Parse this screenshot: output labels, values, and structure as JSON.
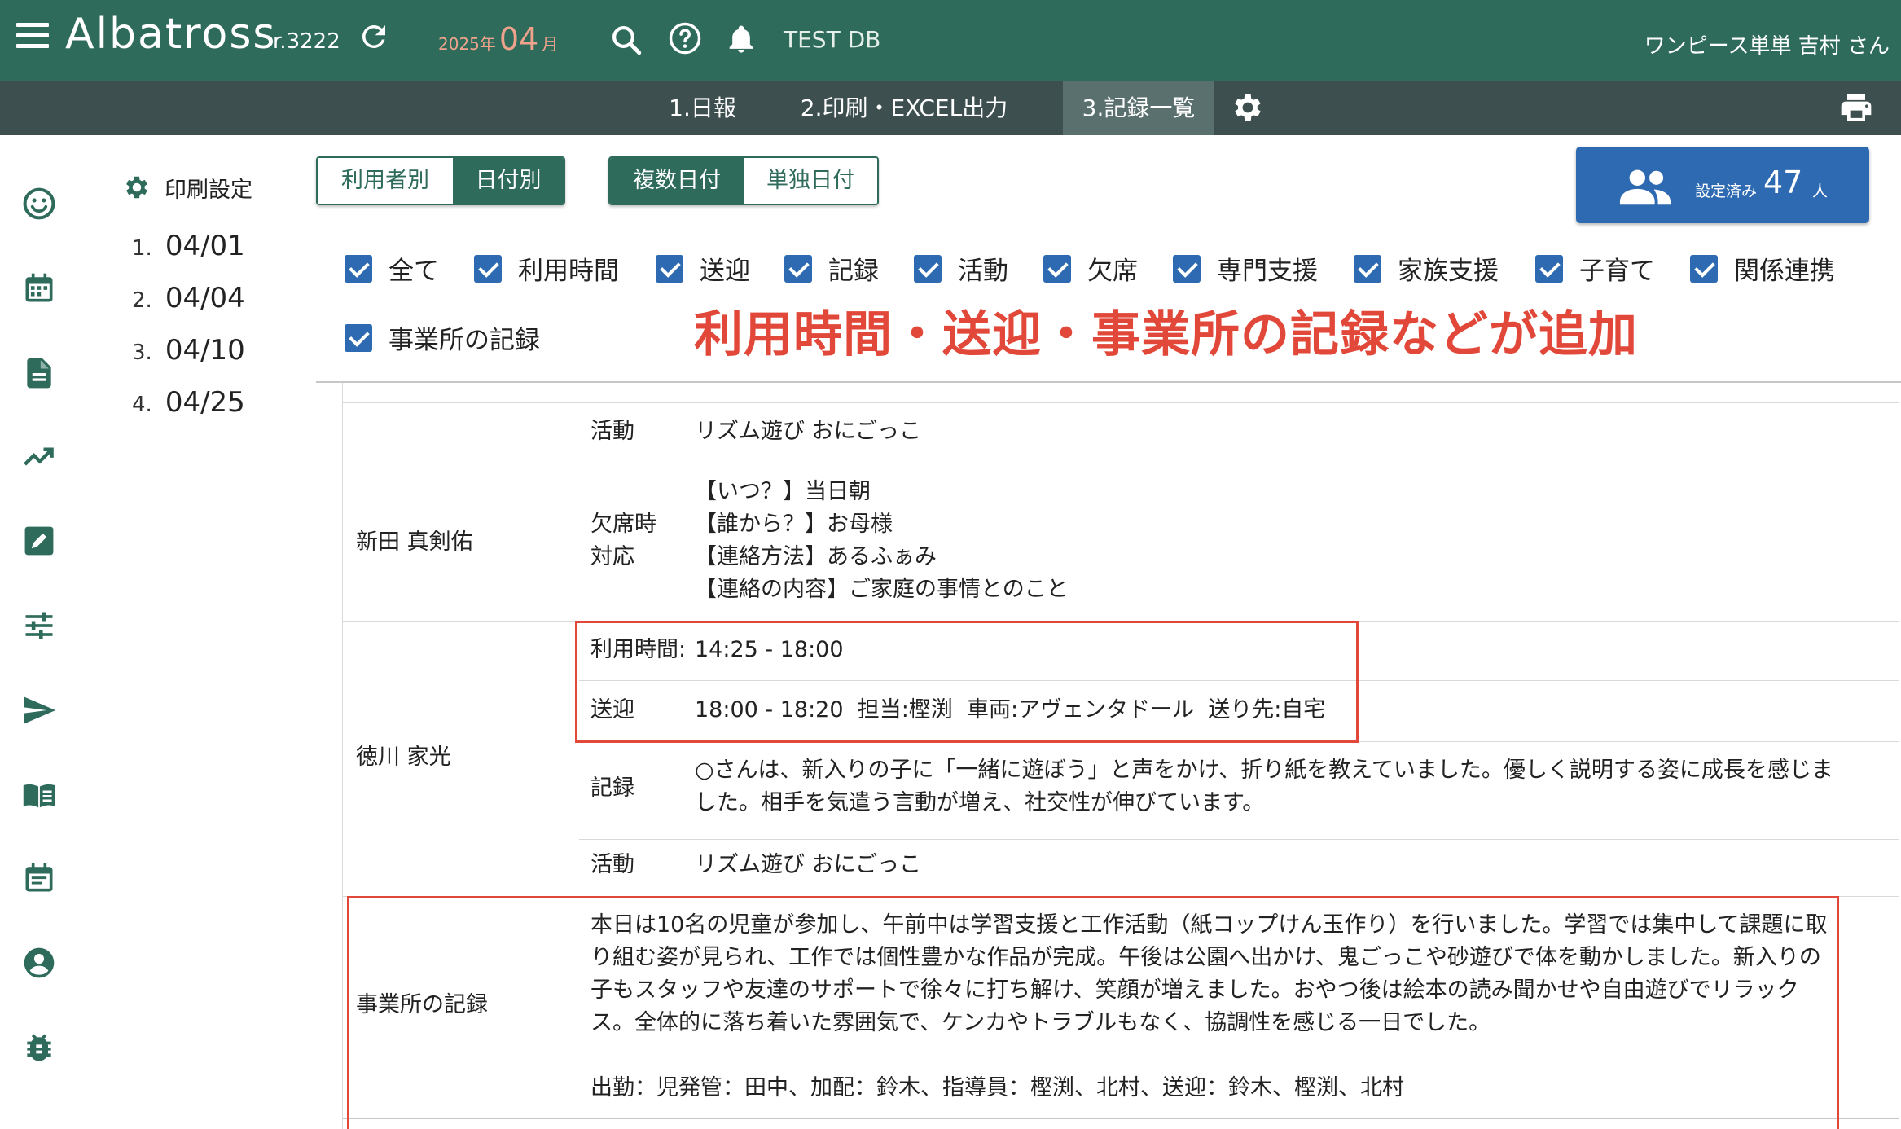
{
  "appbar": {
    "logo": "Albatross",
    "revision": "r.3222",
    "year": "2025年",
    "month": "04",
    "month_unit": "月",
    "db_name": "TEST DB",
    "user": "ワンピース単単 吉村 さん"
  },
  "tabs": [
    {
      "label": "1.日報"
    },
    {
      "label": "2.印刷・EXCEL出力"
    },
    {
      "label": "3.記録一覧",
      "active": true
    }
  ],
  "rail_icons": [
    "smiley-icon",
    "calendar-icon",
    "document-icon",
    "trending-icon",
    "edit-icon",
    "tune-icon",
    "send-icon",
    "book-icon",
    "event-note-icon",
    "account-icon",
    "bug-icon"
  ],
  "date_panel": {
    "print_settings": "印刷設定",
    "dates": [
      {
        "num": "1.",
        "date": "04/01"
      },
      {
        "num": "2.",
        "date": "04/04"
      },
      {
        "num": "3.",
        "date": "04/10"
      },
      {
        "num": "4.",
        "date": "04/25"
      }
    ]
  },
  "view_toggle": {
    "by_user": "利用者別",
    "by_date": "日付別",
    "selected": "日付別"
  },
  "date_mode": {
    "multi": "複数日付",
    "single": "単独日付",
    "selected": "複数日付"
  },
  "count_card": {
    "label": "設定済み",
    "value": "47",
    "unit": "人"
  },
  "filters": [
    {
      "label": "全て",
      "checked": true
    },
    {
      "label": "利用時間",
      "checked": true
    },
    {
      "label": "送迎",
      "checked": true
    },
    {
      "label": "記録",
      "checked": true
    },
    {
      "label": "活動",
      "checked": true
    },
    {
      "label": "欠席",
      "checked": true
    },
    {
      "label": "専門支援",
      "checked": true
    },
    {
      "label": "家族支援",
      "checked": true
    },
    {
      "label": "子育て",
      "checked": true
    },
    {
      "label": "関係連携",
      "checked": true
    },
    {
      "label": "事業所の記録",
      "checked": true
    }
  ],
  "headline": "利用時間・送迎・事業所の記録などが追加",
  "records": {
    "row0": {
      "label": "活動",
      "value": "リズム遊び おにごっこ"
    },
    "row1": {
      "name": "新田 真剣佑",
      "label_line1": "欠席時",
      "label_line2": "対応",
      "lines": [
        "【いつ？】当日朝",
        "【誰から？】お母様",
        "【連絡方法】あるふぁみ",
        "【連絡の内容】ご家庭の事情とのこと"
      ]
    },
    "row2": {
      "name": "徳川 家光",
      "time_label": "利用時間:",
      "time_value": "14:25 - 18:00",
      "transport_label": "送迎",
      "transport_value": "18:00 - 18:20  担当:樫渕  車両:アヴェンタドール  送り先:自宅",
      "record_label": "記録",
      "record_line1": "○さんは、新入りの子に「一緒に遊ぼう」と声をかけ、折り紙を教えていました。優しく説明する姿に成長を感じま",
      "record_line2": "した。相手を気遣う言動が増え、社交性が伸びています。",
      "activity_label": "活動",
      "activity_value": "リズム遊び おにごっこ"
    },
    "office": {
      "label": "事業所の記録",
      "lines": [
        "本日は10名の児童が参加し、午前中は学習支援と工作活動（紙コップけん玉作り）を行いました。学習では集中して課題に取",
        "り組む姿が見られ、工作では個性豊かな作品が完成。午後は公園へ出かけ、鬼ごっこや砂遊びで体を動かしました。新入りの",
        "子もスタッフや友達のサポートで徐々に打ち解け、笑顔が増えました。おやつ後は絵本の読み聞かせや自由遊びでリラック",
        "ス。全体的に落ち着いた雰囲気で、ケンカやトラブルもなく、協調性を感じる一日でした。"
      ],
      "staff": "出勤：児発管：田中、加配：鈴木、指導員：樫渕、北村、送迎：鈴木、樫渕、北村"
    }
  },
  "colors": {
    "primary": "#2f6b5b",
    "tabbar": "#3d4f4f",
    "accent_blue": "#2d6ab1",
    "highlight_red": "#e2483a"
  }
}
